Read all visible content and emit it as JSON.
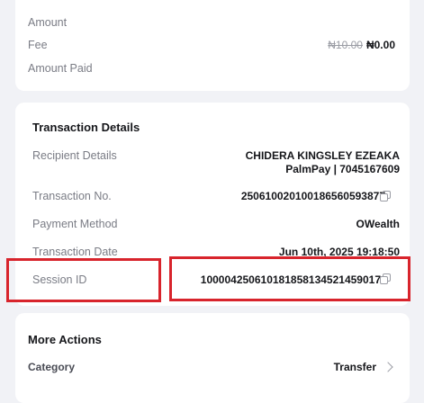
{
  "payment_summary": {
    "amount_label": "Amount",
    "fee_label": "Fee",
    "fee_original": "₦10.00",
    "fee_value": "₦0.00",
    "amount_paid_label": "Amount Paid"
  },
  "transaction_details": {
    "title": "Transaction Details",
    "recipient_label": "Recipient Details",
    "recipient_name": "CHIDERA KINGSLEY EZEAKA",
    "recipient_bank": "PalmPay | 7045167609",
    "transaction_no_label": "Transaction No.",
    "transaction_no_value": "250610020100186560593877",
    "payment_method_label": "Payment Method",
    "payment_method_value": "OWealth",
    "transaction_date_label": "Transaction Date",
    "transaction_date_value": "Jun 10th, 2025 19:18:50",
    "session_id_label": "Session ID",
    "session_id_value": "100004250610181858134521459017"
  },
  "more_actions": {
    "title": "More Actions",
    "category_label": "Category",
    "category_value": "Transfer"
  },
  "colors": {
    "highlight": "#d8242c",
    "background": "#f1f2f6"
  }
}
